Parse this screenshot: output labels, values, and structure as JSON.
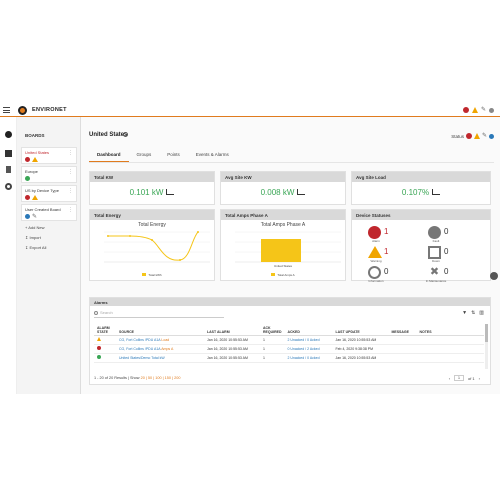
{
  "app": {
    "brand": "ENVIRONET"
  },
  "boards": {
    "title": "BOARDS",
    "items": [
      {
        "label": "United States"
      },
      {
        "label": "Europe"
      },
      {
        "label": "US by Device Type"
      },
      {
        "label": "User Created Board"
      }
    ],
    "actions": [
      {
        "label": "Add New"
      },
      {
        "label": "Import"
      },
      {
        "label": "Export All"
      }
    ]
  },
  "page": {
    "title": "United States",
    "status_label": "Status"
  },
  "tabs": [
    {
      "label": "Dashboard",
      "active": true
    },
    {
      "label": "Groups"
    },
    {
      "label": "Points"
    },
    {
      "label": "Events & Alarms"
    }
  ],
  "kpis": [
    {
      "title": "Total KW",
      "value": "0.101 kW"
    },
    {
      "title": "Avg Site KW",
      "value": "0.008 kW"
    },
    {
      "title": "Avg Site Load",
      "value": "0.107%"
    }
  ],
  "energy_card": {
    "header": "Total Energy",
    "chart_title": "Total Energy",
    "legend": "Total kWh"
  },
  "amps_card": {
    "header": "Total Amps Phase A",
    "chart_title": "Total Amps Phase A",
    "legend": "Total Amps A",
    "x_label": "United States"
  },
  "device_statuses": {
    "header": "Device Statuses",
    "items": [
      {
        "label": "Alarm",
        "count": "1"
      },
      {
        "label": "Fault",
        "count": "0"
      },
      {
        "label": "Warning",
        "count": "1"
      },
      {
        "label": "Down",
        "count": "0"
      },
      {
        "label": "Information",
        "count": "0"
      },
      {
        "label": "In Maintenance",
        "count": "0"
      }
    ]
  },
  "alarms": {
    "header": "Alarms",
    "search_placeholder": "Search",
    "columns": [
      "ALARM STATE",
      "SOURCE",
      "LAST ALARM",
      "ACK REQUIRED",
      "ACKED",
      "LAST UPDATE",
      "MESSAGE",
      "NOTES"
    ],
    "rows": [
      {
        "source": "CG, Fort Collins /PDU A1A",
        "source_tag": "Load",
        "last_alarm": "Jan 16, 2020 10:55:53 AM",
        "ack_req": "1",
        "acked": "2 Unacked / 0 Acked",
        "last_update": "Jan 16, 2020 10:55:53 AM"
      },
      {
        "source": "CG, Fort Collins /PDU A1A",
        "source_tag": "Amps A",
        "last_alarm": "Jan 16, 2020 10:55:53 AM",
        "ack_req": "1",
        "acked": "0 Unacked / 2 Acked",
        "last_update": "Feb 4, 2020 9:38:38 PM"
      },
      {
        "source": "United States/Demo Total kW",
        "source_tag": "",
        "last_alarm": "Jan 16, 2020 10:55:53 AM",
        "ack_req": "1",
        "acked": "2 Unacked / 0 Acked",
        "last_update": "Jan 16, 2020 10:55:53 AM"
      }
    ],
    "pager_text": "1 - 20 of 20 Results | Show",
    "pager_sizes": "20 | 50 | 100 | 150 | 200",
    "page_box": "1",
    "page_of": "of 1"
  },
  "colors": {
    "accent": "#e07b1e",
    "alarm": "#c0272d",
    "warning": "#f0a500",
    "ok": "#3aa655",
    "chart_series": "#f5c518"
  }
}
